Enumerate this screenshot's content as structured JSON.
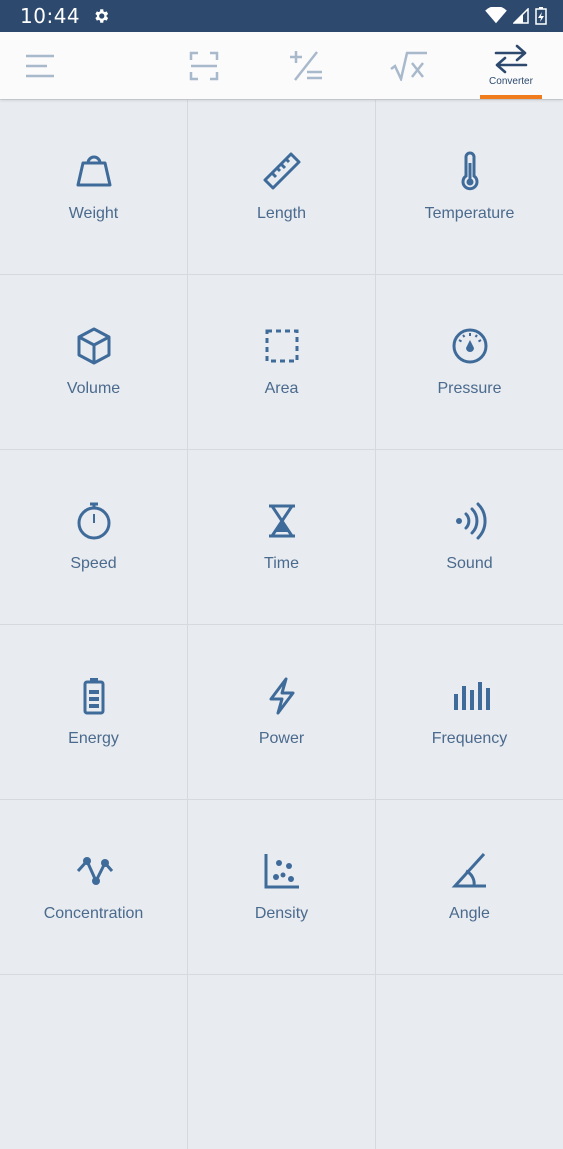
{
  "status": {
    "time": "10:44"
  },
  "toolbar": {
    "converter_label": "Converter"
  },
  "colors": {
    "status_bar": "#2d4a6e",
    "accent": "#f07c1e",
    "icon": "#3f6b9a",
    "icon_inactive": "#a9b9cc"
  },
  "categories": [
    {
      "label": "Weight",
      "icon": "weight-icon"
    },
    {
      "label": "Length",
      "icon": "ruler-icon"
    },
    {
      "label": "Temperature",
      "icon": "thermometer-icon"
    },
    {
      "label": "Volume",
      "icon": "cube-icon"
    },
    {
      "label": "Area",
      "icon": "area-icon"
    },
    {
      "label": "Pressure",
      "icon": "gauge-icon"
    },
    {
      "label": "Speed",
      "icon": "stopwatch-icon"
    },
    {
      "label": "Time",
      "icon": "hourglass-icon"
    },
    {
      "label": "Sound",
      "icon": "sound-icon"
    },
    {
      "label": "Energy",
      "icon": "battery-icon"
    },
    {
      "label": "Power",
      "icon": "lightning-icon"
    },
    {
      "label": "Frequency",
      "icon": "frequency-icon"
    },
    {
      "label": "Concentration",
      "icon": "concentration-icon"
    },
    {
      "label": "Density",
      "icon": "density-icon"
    },
    {
      "label": "Angle",
      "icon": "angle-icon"
    }
  ]
}
